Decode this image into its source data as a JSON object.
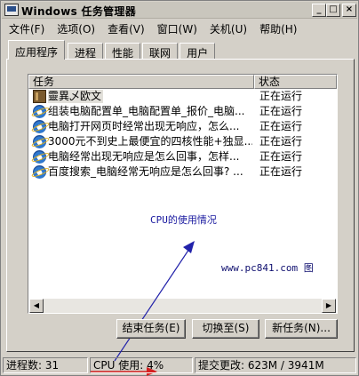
{
  "window": {
    "title": "Windows 任务管理器"
  },
  "title_buttons": {
    "minimize": "_",
    "maximize": "□",
    "close": "×"
  },
  "menu": [
    "文件(F)",
    "选项(O)",
    "查看(V)",
    "窗口(W)",
    "关机(U)",
    "帮助(H)"
  ],
  "tabs": [
    "应用程序",
    "进程",
    "性能",
    "联网",
    "用户"
  ],
  "list": {
    "columns": {
      "task": "任务",
      "status": "状态"
    },
    "rows": [
      {
        "icon": "book-icon",
        "task": "靈異乄欧文",
        "status": "正在运行"
      },
      {
        "icon": "ie-icon",
        "task": "组装电脑配置单_电脑配置单_报价_电脑...",
        "status": "正在运行"
      },
      {
        "icon": "ie-icon",
        "task": "电脑打开网页时经常出现无响应，怎么...",
        "status": "正在运行"
      },
      {
        "icon": "ie-icon",
        "task": "3000元不到史上最便宜的四核性能+独显...",
        "status": "正在运行"
      },
      {
        "icon": "ie-icon",
        "task": "电脑经常出现无响应是怎么回事，怎样...",
        "status": "正在运行"
      },
      {
        "icon": "ie-icon",
        "task": "百度搜索_电脑经常无响应是怎么回事? ...",
        "status": "正在运行"
      }
    ]
  },
  "annotations": {
    "cpu_label": "CPU的使用情况",
    "site": "www.pc841.com 图"
  },
  "buttons": {
    "end_task": "结束任务(E)",
    "switch_to": "切换至(S)",
    "new_task": "新任务(N)..."
  },
  "statusbar": {
    "processes": "进程数: 31",
    "cpu": "CPU 使用: 4%",
    "commit": "提交更改: 623M / 3941M"
  },
  "colors": {
    "annotation_arrow": "#2222aa",
    "highlight_arrow": "#d42020",
    "window_bg": "#d4d0c8"
  }
}
